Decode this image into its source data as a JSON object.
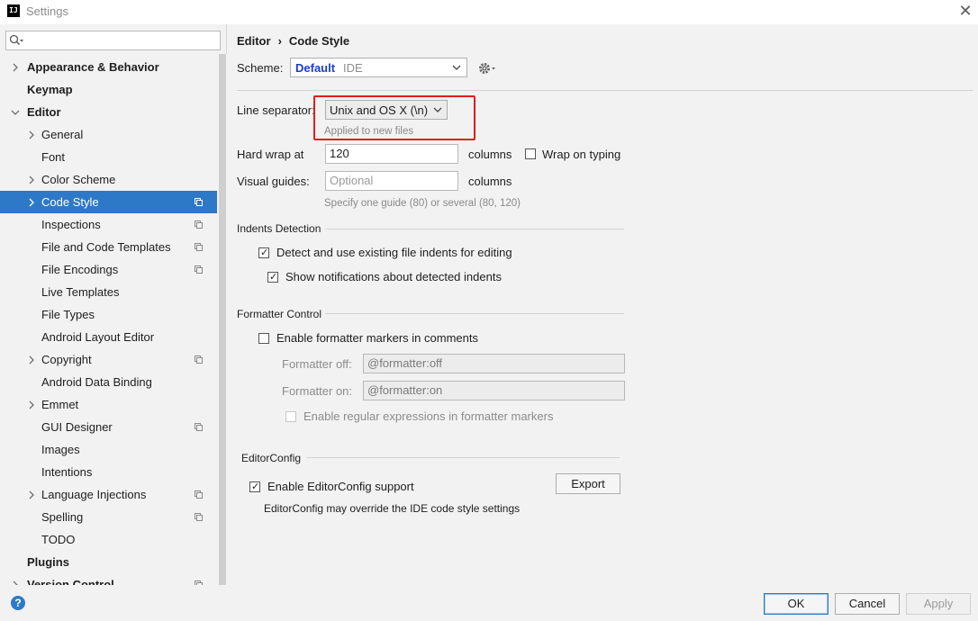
{
  "window": {
    "title": "Settings",
    "app_icon": "IJ",
    "close_glyph": "✕"
  },
  "search": {
    "value": "",
    "placeholder": ""
  },
  "sidebar": {
    "items": [
      {
        "label": "Appearance & Behavior",
        "level": 0,
        "bold": true,
        "arrow": "right"
      },
      {
        "label": "Keymap",
        "level": 0,
        "bold": true,
        "arrow": "none"
      },
      {
        "label": "Editor",
        "level": 0,
        "bold": true,
        "arrow": "down"
      },
      {
        "label": "General",
        "level": 1,
        "arrow": "right"
      },
      {
        "label": "Font",
        "level": 1,
        "arrow": "none"
      },
      {
        "label": "Color Scheme",
        "level": 1,
        "arrow": "right"
      },
      {
        "label": "Code Style",
        "level": 1,
        "arrow": "right",
        "selected": true,
        "project_icon": true
      },
      {
        "label": "Inspections",
        "level": 1,
        "arrow": "none",
        "project_icon": true
      },
      {
        "label": "File and Code Templates",
        "level": 1,
        "arrow": "none",
        "project_icon": true
      },
      {
        "label": "File Encodings",
        "level": 1,
        "arrow": "none",
        "project_icon": true
      },
      {
        "label": "Live Templates",
        "level": 1,
        "arrow": "none"
      },
      {
        "label": "File Types",
        "level": 1,
        "arrow": "none"
      },
      {
        "label": "Android Layout Editor",
        "level": 1,
        "arrow": "none"
      },
      {
        "label": "Copyright",
        "level": 1,
        "arrow": "right",
        "project_icon": true
      },
      {
        "label": "Android Data Binding",
        "level": 1,
        "arrow": "none"
      },
      {
        "label": "Emmet",
        "level": 1,
        "arrow": "right"
      },
      {
        "label": "GUI Designer",
        "level": 1,
        "arrow": "none",
        "project_icon": true
      },
      {
        "label": "Images",
        "level": 1,
        "arrow": "none"
      },
      {
        "label": "Intentions",
        "level": 1,
        "arrow": "none"
      },
      {
        "label": "Language Injections",
        "level": 1,
        "arrow": "right",
        "project_icon": true
      },
      {
        "label": "Spelling",
        "level": 1,
        "arrow": "none",
        "project_icon": true
      },
      {
        "label": "TODO",
        "level": 1,
        "arrow": "none"
      },
      {
        "label": "Plugins",
        "level": 0,
        "bold": true,
        "arrow": "none"
      },
      {
        "label": "Version Control",
        "level": 0,
        "bold": true,
        "arrow": "right",
        "project_icon": true
      }
    ]
  },
  "breadcrumb": {
    "parent": "Editor",
    "separator": "›",
    "current": "Code Style"
  },
  "scheme": {
    "label": "Scheme:",
    "name": "Default",
    "sub": "IDE"
  },
  "line_separator": {
    "label": "Line separator:",
    "value": "Unix and OS X (\\n)",
    "hint": "Applied to new files"
  },
  "hard_wrap": {
    "label": "Hard wrap at",
    "value": "120",
    "unit": "columns"
  },
  "wrap_on_typing": {
    "label": "Wrap on typing",
    "checked": false
  },
  "visual_guides": {
    "label": "Visual guides:",
    "placeholder": "Optional",
    "unit": "columns",
    "hint": "Specify one guide (80) or several (80, 120)"
  },
  "indents": {
    "title": "Indents Detection",
    "detect": {
      "label": "Detect and use existing file indents for editing",
      "checked": true
    },
    "notify": {
      "label": "Show notifications about detected indents",
      "checked": true
    }
  },
  "formatter": {
    "title": "Formatter Control",
    "enable": {
      "label": "Enable formatter markers in comments",
      "checked": false
    },
    "off": {
      "label": "Formatter off:",
      "value": "@formatter:off"
    },
    "on": {
      "label": "Formatter on:",
      "value": "@formatter:on"
    },
    "regex": {
      "label": "Enable regular expressions in formatter markers",
      "checked": false
    }
  },
  "editorconfig": {
    "title": "EditorConfig",
    "enable": {
      "label": "Enable EditorConfig support",
      "checked": true
    },
    "export_label": "Export",
    "note": "EditorConfig may override the IDE code style settings"
  },
  "buttons": {
    "ok": "OK",
    "cancel": "Cancel",
    "apply": "Apply",
    "help": "?"
  },
  "colors": {
    "accent": "#2e79c7",
    "highlight_box": "#e31c1c",
    "scheme_name": "#1b3dd1"
  }
}
